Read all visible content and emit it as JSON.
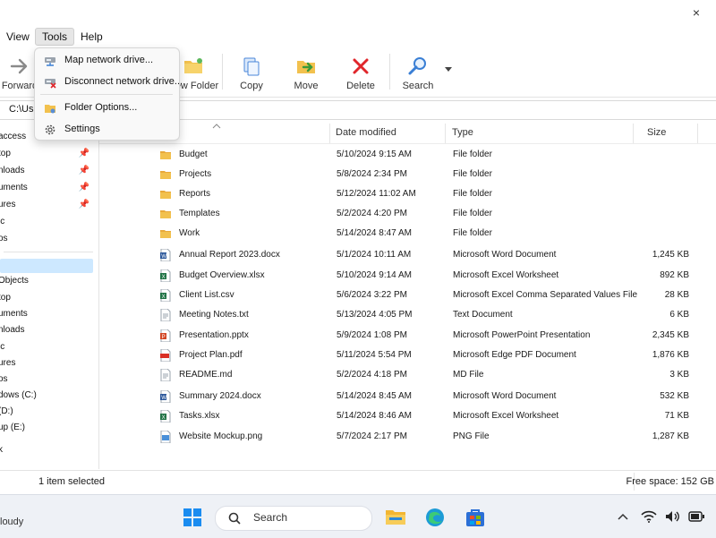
{
  "window": {
    "close_glyph": "×"
  },
  "menubar": {
    "items": [
      {
        "label": "View"
      },
      {
        "label": "Tools"
      },
      {
        "label": "Help"
      }
    ]
  },
  "tools_menu": {
    "items": [
      {
        "label": "Map network drive...",
        "icon": "network-drive-icon"
      },
      {
        "label": "Disconnect network drive...",
        "icon": "disconnect-drive-icon"
      },
      {
        "label": "Folder Options...",
        "icon": "folder-options-icon"
      },
      {
        "label": "Settings",
        "icon": "gear-icon"
      }
    ]
  },
  "toolbar": {
    "forward_label": "Forward",
    "new_folder_label": "New Folder",
    "copy_label": "Copy",
    "move_label": "Move",
    "delete_label": "Delete",
    "search_label": "Search"
  },
  "address": {
    "path": "C:\\Use"
  },
  "nav": {
    "items": [
      {
        "label": "access"
      },
      {
        "label": "top",
        "pinned": true
      },
      {
        "label": "nloads",
        "pinned": true
      },
      {
        "label": "uments",
        "pinned": true
      },
      {
        "label": "ures",
        "pinned": true
      },
      {
        "label": "ic"
      },
      {
        "label": "os"
      },
      {
        "label": ""
      },
      {
        "label": "Objects"
      },
      {
        "label": "top"
      },
      {
        "label": "uments"
      },
      {
        "label": "nloads"
      },
      {
        "label": "ic"
      },
      {
        "label": "ures"
      },
      {
        "label": "os"
      },
      {
        "label": "dows (C:)"
      },
      {
        "label": "(D:)"
      },
      {
        "label": "up (E:)"
      },
      {
        "label": "k"
      }
    ]
  },
  "columns": {
    "date": "Date modified",
    "type": "Type",
    "size": "Size"
  },
  "files": [
    {
      "name": "Budget",
      "date": "5/10/2024 9:15 AM",
      "type": "File folder",
      "size": "",
      "kind": "folder"
    },
    {
      "name": "Projects",
      "date": "5/8/2024 2:34 PM",
      "type": "File folder",
      "size": "",
      "kind": "folder"
    },
    {
      "name": "Reports",
      "date": "5/12/2024 11:02 AM",
      "type": "File folder",
      "size": "",
      "kind": "folder"
    },
    {
      "name": "Templates",
      "date": "5/2/2024 4:20 PM",
      "type": "File folder",
      "size": "",
      "kind": "folder"
    },
    {
      "name": "Work",
      "date": "5/14/2024 8:47 AM",
      "type": "File folder",
      "size": "",
      "kind": "folder"
    },
    {
      "name": "Annual Report 2023.docx",
      "date": "5/1/2024 10:11 AM",
      "type": "Microsoft Word Document",
      "size": "1,245 KB",
      "kind": "word"
    },
    {
      "name": "Budget Overview.xlsx",
      "date": "5/10/2024 9:14 AM",
      "type": "Microsoft Excel Worksheet",
      "size": "892 KB",
      "kind": "excel"
    },
    {
      "name": "Client List.csv",
      "date": "5/6/2024 3:22 PM",
      "type": "Microsoft Excel Comma Separated Values File",
      "size": "28 KB",
      "kind": "excel"
    },
    {
      "name": "Meeting Notes.txt",
      "date": "5/13/2024 4:05 PM",
      "type": "Text Document",
      "size": "6 KB",
      "kind": "text"
    },
    {
      "name": "Presentation.pptx",
      "date": "5/9/2024 1:08 PM",
      "type": "Microsoft PowerPoint Presentation",
      "size": "2,345 KB",
      "kind": "ppt"
    },
    {
      "name": "Project Plan.pdf",
      "date": "5/11/2024 5:54 PM",
      "type": "Microsoft Edge PDF Document",
      "size": "1,876 KB",
      "kind": "pdf"
    },
    {
      "name": "README.md",
      "date": "5/2/2024 4:18 PM",
      "type": "MD File",
      "size": "3 KB",
      "kind": "text"
    },
    {
      "name": "Summary 2024.docx",
      "date": "5/14/2024 8:45 AM",
      "type": "Microsoft Word Document",
      "size": "532 KB",
      "kind": "word"
    },
    {
      "name": "Tasks.xlsx",
      "date": "5/14/2024 8:46 AM",
      "type": "Microsoft Excel Worksheet",
      "size": "71 KB",
      "kind": "excel"
    },
    {
      "name": "Website Mockup.png",
      "date": "5/7/2024 2:17 PM",
      "type": "PNG File",
      "size": "1,287 KB",
      "kind": "image"
    }
  ],
  "status": {
    "selected": "1 item selected",
    "free_space": "Free space: 152 GB"
  },
  "taskbar": {
    "weather": "loudy",
    "search_label": "Search"
  },
  "colors": {
    "selection": "#cde8ff",
    "delete_red": "#e0262b",
    "folder_yellow": "#f2c14e",
    "accent_blue": "#1a73e8"
  }
}
